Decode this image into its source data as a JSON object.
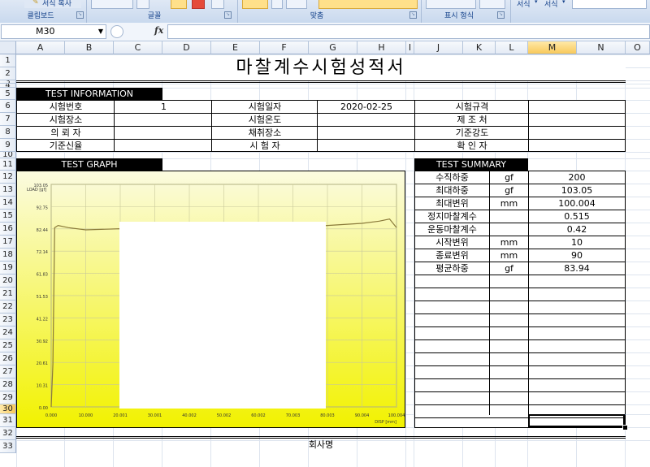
{
  "ribbon": {
    "groups": [
      "클립보드",
      "글꼴",
      "맞춤",
      "표시 형식"
    ],
    "clipboard_btn": "서식 복사",
    "style_btns": [
      "서식",
      "서식"
    ]
  },
  "formula_bar": {
    "name_box": "M30",
    "fx": "fx",
    "content": ""
  },
  "columns": [
    "A",
    "B",
    "C",
    "D",
    "E",
    "F",
    "G",
    "H",
    "I",
    "J",
    "K",
    "L",
    "M",
    "N",
    "O"
  ],
  "rows": [
    "1",
    "2",
    "3",
    "4",
    "5",
    "6",
    "7",
    "8",
    "9",
    "10",
    "11",
    "12",
    "13",
    "14",
    "15",
    "16",
    "17",
    "18",
    "19",
    "20",
    "21",
    "22",
    "23",
    "24",
    "25",
    "26",
    "27",
    "28",
    "29",
    "30",
    "31",
    "32",
    "33"
  ],
  "selected": {
    "column": "M",
    "row": "30"
  },
  "title": "마찰계수시험성적서",
  "info": {
    "header": "TEST INFORMATION",
    "rows": [
      [
        "시험번호",
        "1",
        "시험일자",
        "2020-02-25",
        "시험규격",
        ""
      ],
      [
        "시험장소",
        "",
        "시험온도",
        "",
        "제 조 처",
        ""
      ],
      [
        "의 뢰 자",
        "",
        "채취장소",
        "",
        "기준강도",
        ""
      ],
      [
        "기준신율",
        "",
        "시 험 자",
        "",
        "확 인 자",
        ""
      ]
    ]
  },
  "graph_header": "TEST GRAPH",
  "chart_data": {
    "type": "line",
    "ylabel": "LOAD [gf]",
    "xlabel": "DISP [mm]",
    "y_ticks": [
      "103.05",
      "92.75",
      "82.44",
      "72.14",
      "61.83",
      "51.53",
      "41.22",
      "30.92",
      "20.61",
      "10.31",
      "0.00"
    ],
    "x_ticks": [
      "0.000",
      "10.000",
      "20.001",
      "30.001",
      "40.002",
      "50.002",
      "60.002",
      "70.003",
      "80.003",
      "90.004",
      "100.004"
    ],
    "ylim": [
      0,
      103.05
    ],
    "xlim": [
      0,
      100.004
    ],
    "grid": true,
    "series": [
      {
        "x": [
          0,
          0.5,
          1,
          2,
          5,
          10,
          20,
          30,
          40,
          50,
          60,
          70,
          80,
          90,
          95,
          98,
          100
        ],
        "values": [
          0,
          20,
          83,
          84,
          83,
          82,
          82.5,
          82,
          82,
          83,
          82,
          83,
          84,
          85,
          86,
          87,
          83
        ]
      }
    ],
    "line_color": "#8a7a3a",
    "background_gradient": [
      "#fbfbe0",
      "#f2f200"
    ]
  },
  "summary": {
    "header": "TEST SUMMARY",
    "rows": [
      [
        "수직하중",
        "gf",
        "200"
      ],
      [
        "최대하중",
        "gf",
        "103.05"
      ],
      [
        "최대변위",
        "mm",
        "100.004"
      ],
      [
        "정지마찰계수",
        "",
        "0.515"
      ],
      [
        "운동마찰계수",
        "",
        "0.42"
      ],
      [
        "시작변위",
        "mm",
        "10"
      ],
      [
        "종료변위",
        "mm",
        "90"
      ],
      [
        "평균하중",
        "gf",
        "83.94"
      ]
    ]
  },
  "footer": "회사명"
}
